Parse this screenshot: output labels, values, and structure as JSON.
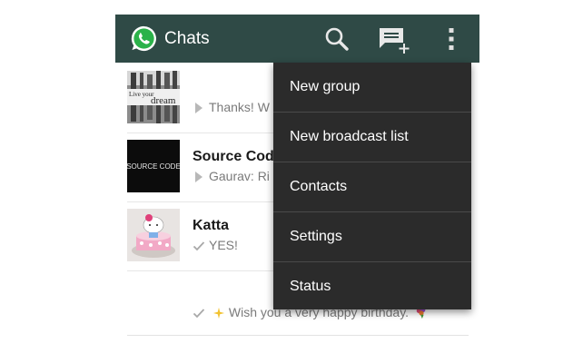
{
  "header": {
    "title": "Chats",
    "logo_icon": "whatsapp-logo-icon",
    "actions": [
      "search-icon",
      "new-chat-icon",
      "overflow-menu-icon"
    ],
    "background": "#2f4a46"
  },
  "chats": [
    {
      "avatar_text": [
        "Live your",
        "dream"
      ],
      "name": "",
      "preview": "Thanks! W",
      "status_icon": "sent-arrow-icon"
    },
    {
      "avatar_text": [
        "SOURCE CODE"
      ],
      "name": "Source Code",
      "preview": "Gaurav: Ri",
      "status_icon": "sent-arrow-icon"
    },
    {
      "name": "Katta",
      "preview": "YES!",
      "status_icon": "checkmark-icon"
    }
  ],
  "bottom_preview": {
    "text": "Wish you a very happy birthday.",
    "status_icon": "checkmark-icon"
  },
  "menu": {
    "items": [
      "New group",
      "New broadcast list",
      "Contacts",
      "Settings",
      "Status"
    ],
    "background": "#2b2b2b"
  }
}
